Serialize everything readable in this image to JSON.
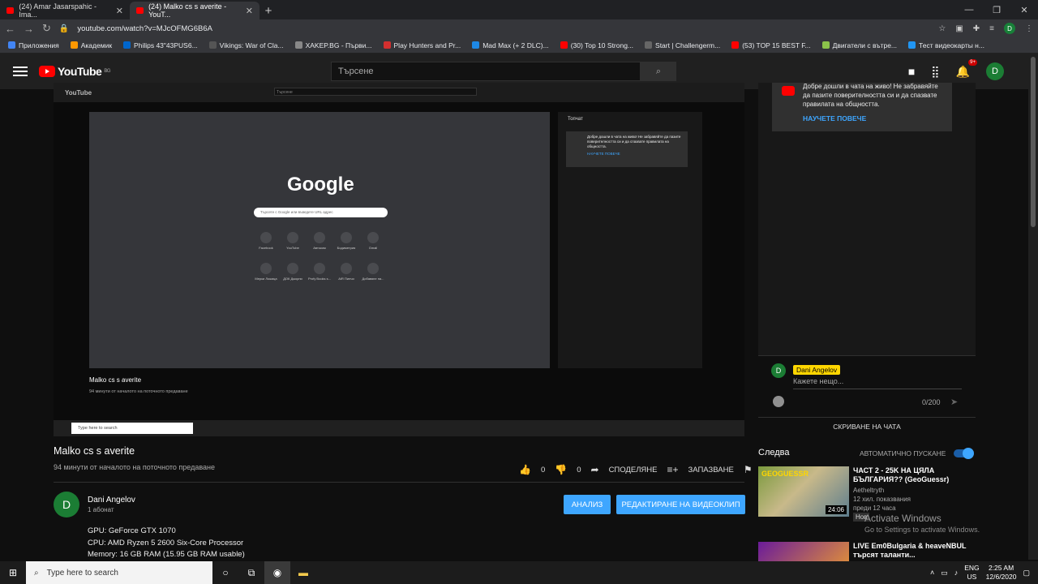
{
  "browser": {
    "tabs": [
      {
        "title": "(24) Amar Jasarspahic - Ima..."
      },
      {
        "title": "(24) Malko cs s averite - YouT..."
      }
    ],
    "url": "youtube.com/watch?v=MJcOFMG6B6A",
    "bookmarks": [
      {
        "label": "Приложения",
        "color": "#4285f4"
      },
      {
        "label": "Академик",
        "color": "#ff9800"
      },
      {
        "label": "Philips 43\"43PUS6...",
        "color": "#0066cc"
      },
      {
        "label": "Vikings: War of Cla...",
        "color": "#555"
      },
      {
        "label": "XAKEP.BG - Първи...",
        "color": "#888"
      },
      {
        "label": "Play Hunters and Pr...",
        "color": "#d32f2f"
      },
      {
        "label": "Mad Max (+ 2 DLC)...",
        "color": "#1e88e5"
      },
      {
        "label": "(30) Top 10 Strong...",
        "color": "#f00"
      },
      {
        "label": "Start | Challengerm...",
        "color": "#666"
      },
      {
        "label": "(53) TOP 15 BEST F...",
        "color": "#f00"
      },
      {
        "label": "Двигатели с вътре...",
        "color": "#8bc34a"
      },
      {
        "label": "Тест видеокарты н...",
        "color": "#2196f3"
      }
    ]
  },
  "youtube": {
    "logo_text": "YouTube",
    "region": "BG",
    "search_placeholder": "Търсене",
    "notif_count": "9+",
    "user_initial": "D"
  },
  "inner": {
    "google": "Google",
    "search_hint": "Търсете с Google или въведете URL адрес",
    "shortcuts": [
      "Facebook",
      "YouTube",
      "Автоком",
      "Бодиметрия",
      "Gmail",
      "Мерки Ложица",
      "ДОК Джорни",
      "Profy Books s...",
      "AIR Пинчи",
      "Добавяне на..."
    ],
    "chat_title": "Топчат",
    "chat_msg": "Добре дошли в чата на живо! Не забравяйте да пазите поверителността си и да спазвате правилата на общността.",
    "chat_link": "НАУЧЕТЕ ПОВЕЧЕ",
    "video_title": "Malko cs s averite",
    "video_sub": "94 минути от началото на поточното предаване",
    "search_here": "Type here to search"
  },
  "chat": {
    "welcome": "Добре дошли в чата на живо! Не забравяйте да пазите поверителността си и да спазвате правилата на общността.",
    "learn_more": "НАУЧЕТЕ ПОВЕЧЕ",
    "username": "Dani Angelov",
    "input_placeholder": "Кажете нещо...",
    "counter": "0/200",
    "hide": "СКРИВАНЕ НА ЧАТА"
  },
  "video": {
    "title": "Malko cs s averite",
    "subtitle": "94 минути от началото на поточното предаване",
    "likes": "0",
    "dislikes": "0",
    "share": "СПОДЕЛЯНЕ",
    "save": "ЗАПАЗВАНЕ"
  },
  "channel": {
    "initial": "D",
    "name": "Dani Angelov",
    "subs": "1 абонат",
    "analysis": "АНАЛИЗ",
    "edit": "РЕДАКТИРАНЕ НА ВИДЕОКЛИП"
  },
  "description": [
    "GPU: GeForce GTX 1070",
    "CPU: AMD Ryzen 5 2600 Six-Core Processor",
    "Memory: 16 GB RAM (15.95 GB RAM usable)"
  ],
  "up_next": {
    "label": "Следва",
    "autoplay": "АВТОМАТИЧНО ПУСКАНЕ",
    "items": [
      {
        "title": "ЧАСТ 2 - 25K НА ЦЯЛА БЪЛГАРИЯ?? (GeoGuessr)",
        "channel": "Aetheltryth",
        "views": "12 хил. показвания",
        "age": "преди 12 часа",
        "badge": "Нов",
        "duration": "24:06",
        "thumb_text": "GEOGUESSR"
      },
      {
        "title": "LIVE Em0Bulgaria & heaveNBUL търсят таланти...",
        "channel": "",
        "views": "",
        "age": "",
        "badge": "",
        "duration": "",
        "thumb_text": ""
      }
    ]
  },
  "watermark": {
    "title": "Activate Windows",
    "sub": "Go to Settings to activate Windows."
  },
  "taskbar": {
    "search": "Type here to search",
    "lang": "ENG",
    "region": "US",
    "time": "2:25 AM",
    "date": "12/6/2020"
  }
}
